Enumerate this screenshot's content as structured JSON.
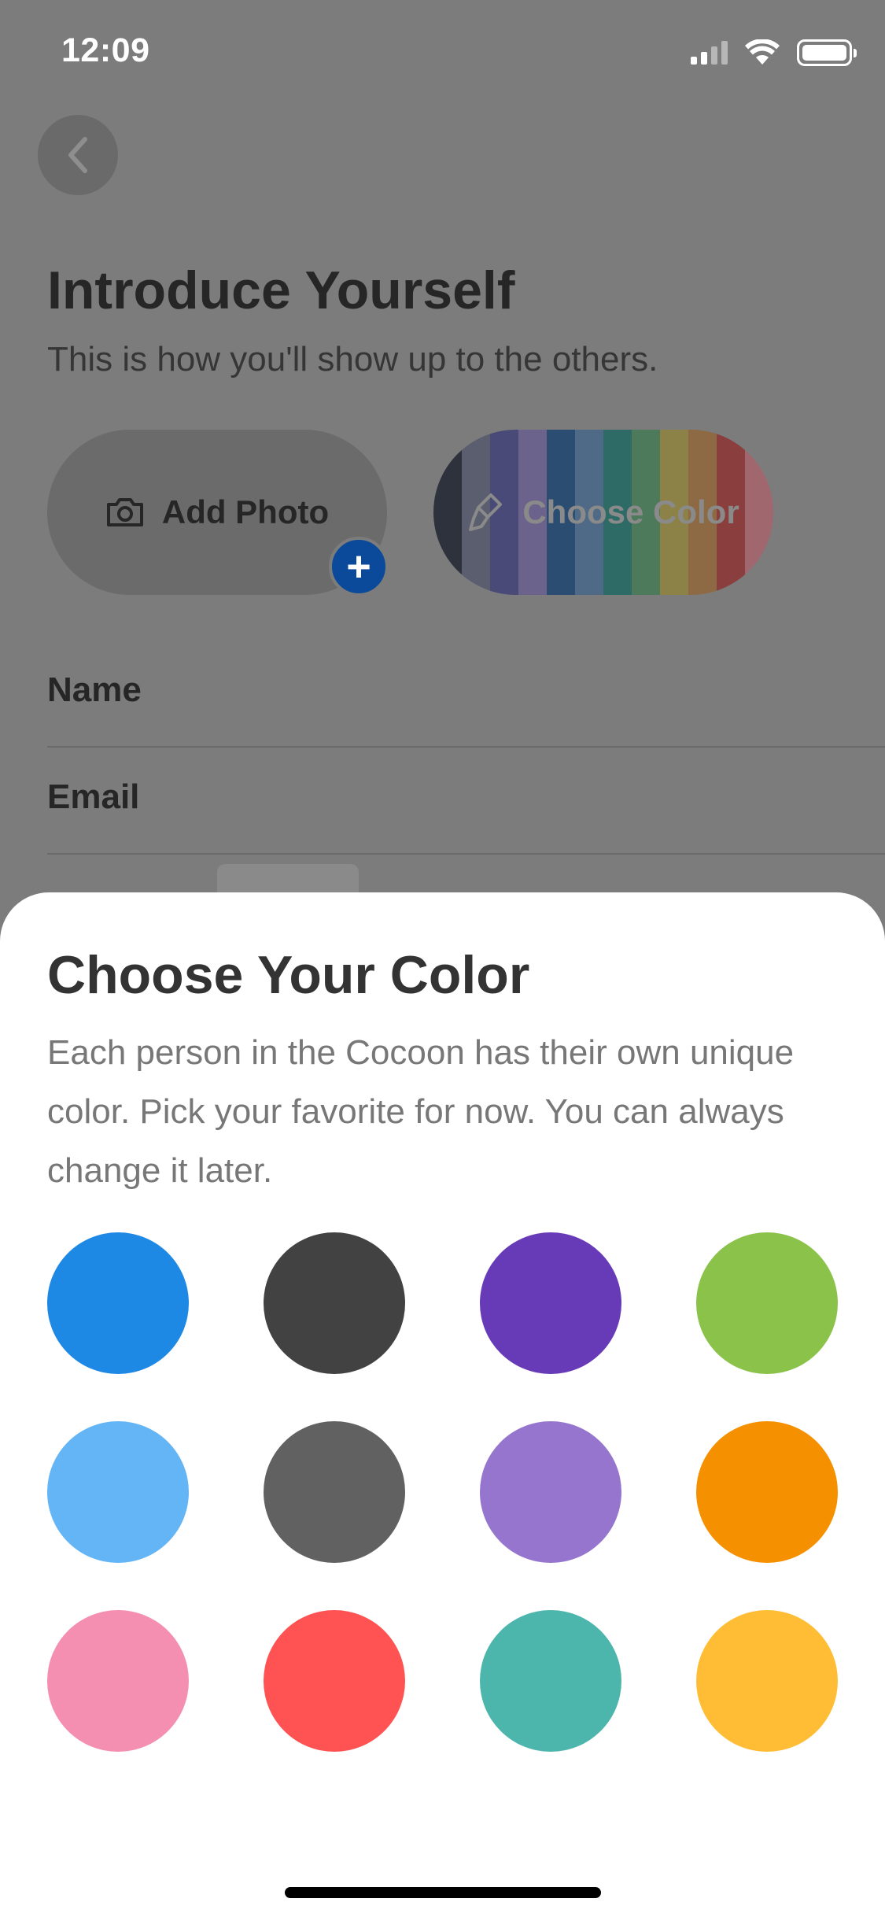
{
  "status_bar": {
    "time": "12:09"
  },
  "header": {
    "title": "Introduce Yourself",
    "subtitle": "This is how you'll show up to the others."
  },
  "actions": {
    "add_photo_label": "Add Photo",
    "add_badge": "+",
    "choose_color_label": "Choose Color",
    "stripe_colors": [
      "#2e323c",
      "#5a5e6e",
      "#4a4a78",
      "#6c638c",
      "#2b4d72",
      "#4e6a86",
      "#2f6b66",
      "#4c7a5a",
      "#8c8248",
      "#8e6a44",
      "#8a3e3e",
      "#a0686e"
    ]
  },
  "form": {
    "name_label": "Name",
    "email_label": "Email"
  },
  "color_sheet": {
    "title": "Choose Your Color",
    "description": "Each person in the Cocoon has their own unique color. Pick your favorite for now. You can always change it later.",
    "swatches": [
      {
        "name": "blue",
        "color": "#1e88e5"
      },
      {
        "name": "dark-gray",
        "color": "#424242"
      },
      {
        "name": "purple",
        "color": "#673ab7"
      },
      {
        "name": "green",
        "color": "#8bc34a"
      },
      {
        "name": "light-blue",
        "color": "#64b5f6"
      },
      {
        "name": "gray",
        "color": "#616161"
      },
      {
        "name": "lavender",
        "color": "#9575cd"
      },
      {
        "name": "orange",
        "color": "#f59000"
      },
      {
        "name": "pink",
        "color": "#f48fb1"
      },
      {
        "name": "red",
        "color": "#ff5252"
      },
      {
        "name": "teal",
        "color": "#4db6ac"
      },
      {
        "name": "yellow",
        "color": "#ffbd35"
      }
    ]
  }
}
